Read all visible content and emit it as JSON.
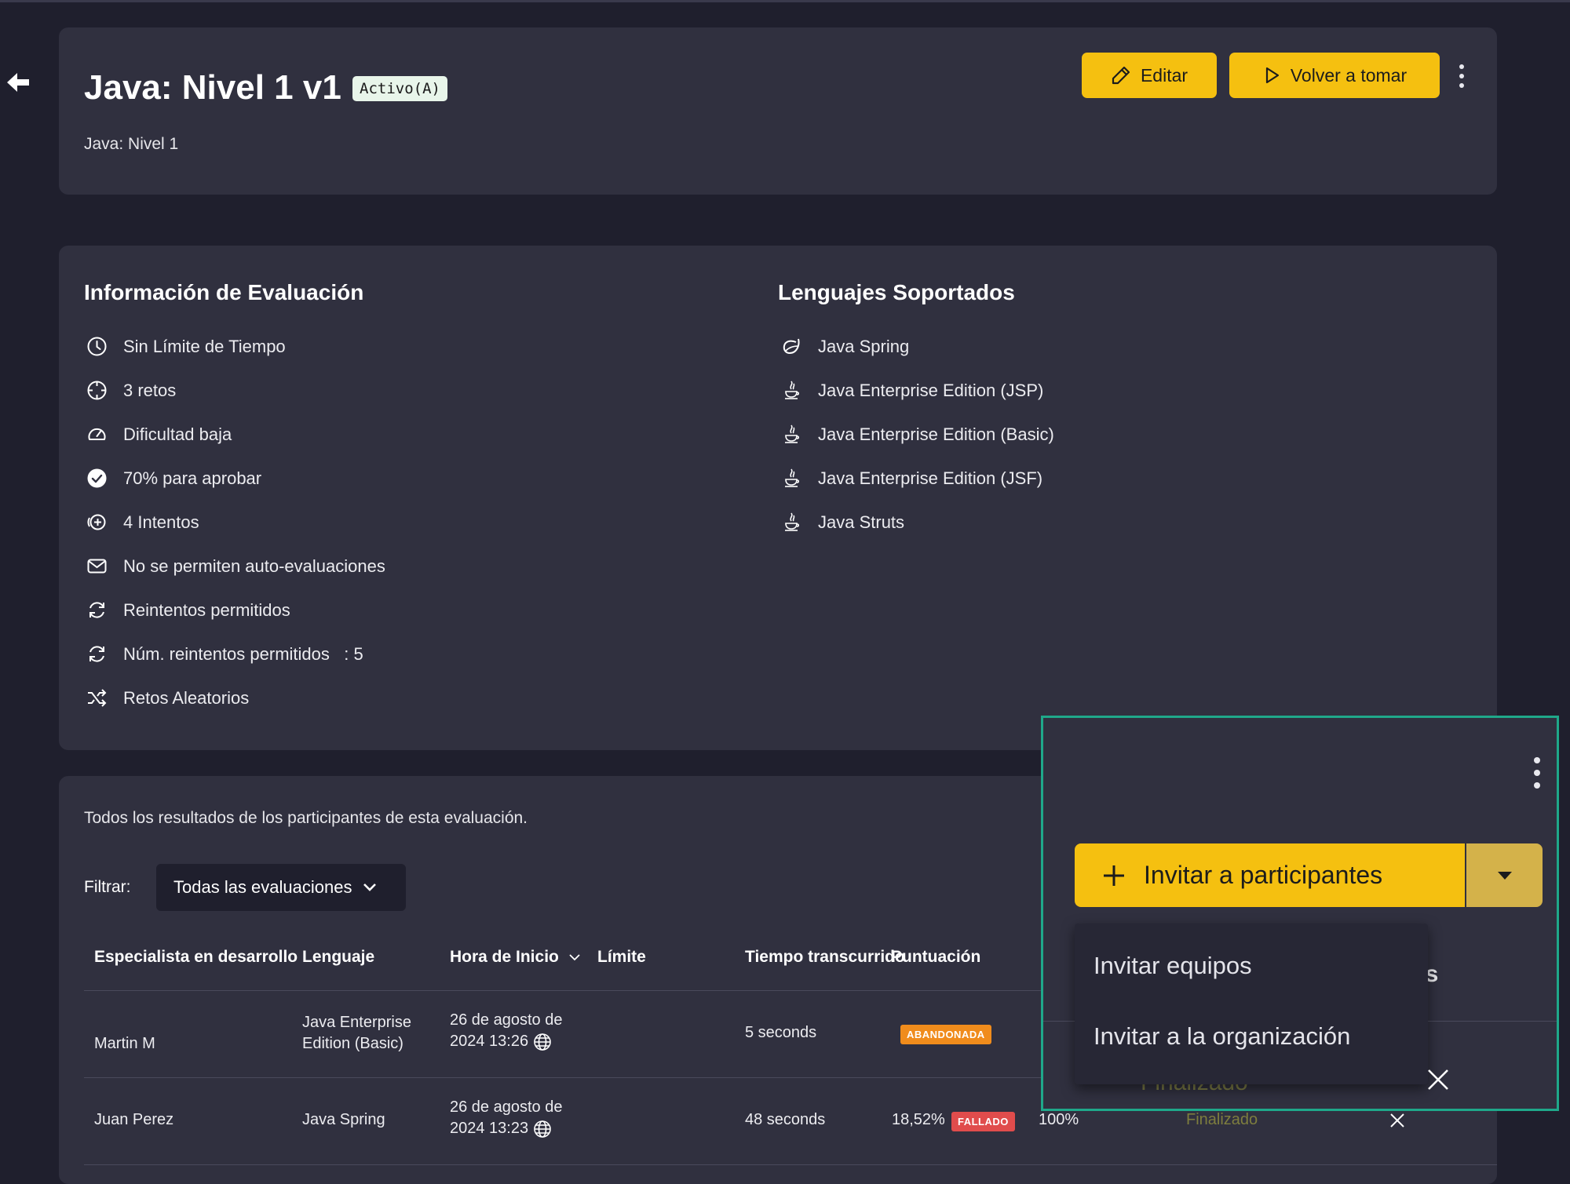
{
  "header": {
    "title": "Java: Nivel 1 v1",
    "badge": "Activo(A)",
    "subtitle": "Java: Nivel 1",
    "edit_label": "Editar",
    "retake_label": "Volver a tomar"
  },
  "info": {
    "title": "Información de Evaluación",
    "items": [
      {
        "icon": "clock-icon",
        "label": "Sin Límite de Tiempo"
      },
      {
        "icon": "crosshair-icon",
        "label": "3 retos"
      },
      {
        "icon": "gauge-icon",
        "label": "Dificultad baja"
      },
      {
        "icon": "check-circle-icon",
        "label": "70% para aprobar"
      },
      {
        "icon": "plus-circle-icon",
        "label": "4 Intentos"
      },
      {
        "icon": "mail-icon",
        "label": "No se permiten auto-evaluaciones"
      },
      {
        "icon": "refresh-icon",
        "label": "Reintentos permitidos"
      },
      {
        "icon": "refresh-icon",
        "label": "Núm. reintentos permitidos   : 5"
      },
      {
        "icon": "shuffle-icon",
        "label": "Retos Aleatorios"
      }
    ]
  },
  "languages": {
    "title": "Lenguajes Soportados",
    "items": [
      {
        "icon": "spring-icon",
        "label": "Java Spring"
      },
      {
        "icon": "java-icon",
        "label": "Java Enterprise Edition (JSP)"
      },
      {
        "icon": "java-icon",
        "label": "Java Enterprise Edition (Basic)"
      },
      {
        "icon": "java-icon",
        "label": "Java Enterprise Edition (JSF)"
      },
      {
        "icon": "java-icon",
        "label": "Java Struts"
      }
    ]
  },
  "results": {
    "description": "Todos los resultados de los participantes de esta evaluación.",
    "filter_label": "Filtrar:",
    "filter_value": "Todas las evaluaciones",
    "columns": [
      "Especialista en desarrollo",
      "Lenguaje",
      "Hora de Inicio",
      "Límite",
      "Tiempo transcurrido",
      "Puntuación"
    ],
    "rows": [
      {
        "name": "Martin M",
        "language_1": "Java Enterprise",
        "language_2": "Edition (Basic)",
        "start_1": "26 de agosto de",
        "start_2": "2024 13:26",
        "elapsed": "5 seconds",
        "score": "",
        "status_badge": "ABANDONADA"
      },
      {
        "name": "Juan Perez",
        "language": "Java Spring",
        "start_1": "26 de agosto de",
        "start_2": "2024 13:23",
        "elapsed": "48 seconds",
        "score": "18,52%",
        "status_badge": "FALLADO",
        "progress": "100%",
        "state": "Finalizado"
      }
    ]
  },
  "popup": {
    "invite_label": "Invitar a participantes",
    "menu_items": [
      "Invitar equipos",
      "Invitar a la organización"
    ],
    "partial_header": "es",
    "faded_status": "Finalizado"
  },
  "colors": {
    "accent": "#f5c010",
    "card": "#30303f",
    "background": "#1f1f2d",
    "abandoned": "#f08c1c",
    "failed": "#e04c4c",
    "overlay_border": "#1fa88a"
  }
}
